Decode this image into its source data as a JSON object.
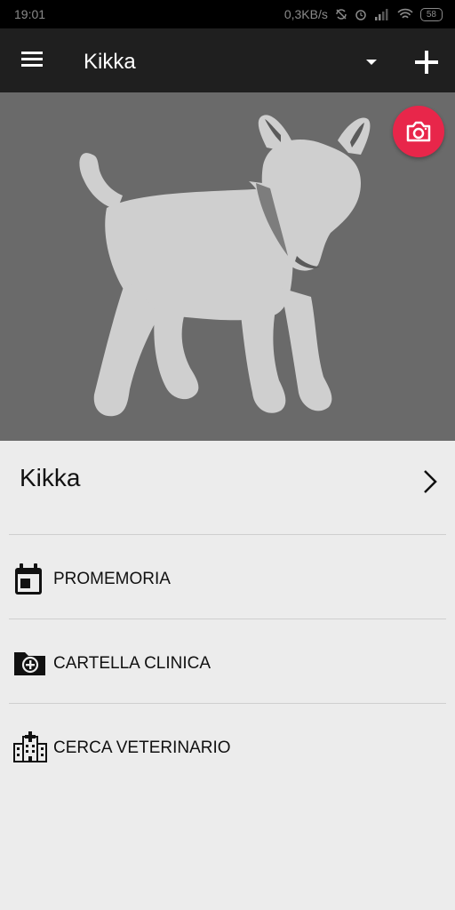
{
  "status_bar": {
    "time": "19:01",
    "network_speed": "0,3KB/s",
    "battery": "58",
    "icons": [
      "sync-off-icon",
      "alarm-icon",
      "signal-icon",
      "wifi-icon",
      "battery-icon"
    ]
  },
  "app_bar": {
    "title": "Kikka",
    "icons": [
      "menu-icon",
      "dropdown-icon",
      "add-icon"
    ]
  },
  "hero": {
    "image": "dog-silhouette",
    "camera_button_icon": "camera-icon",
    "colors": {
      "background": "#6a6a6a",
      "silhouette": "#cfcfcf",
      "camera_button": "#e8264a"
    }
  },
  "pet": {
    "name": "Kikka"
  },
  "menu": {
    "items": [
      {
        "label": "PROMEMORIA",
        "icon": "calendar-icon"
      },
      {
        "label": "CARTELLA CLINICA",
        "icon": "medical-folder-icon"
      },
      {
        "label": "CERCA VETERINARIO",
        "icon": "hospital-icon"
      }
    ]
  }
}
